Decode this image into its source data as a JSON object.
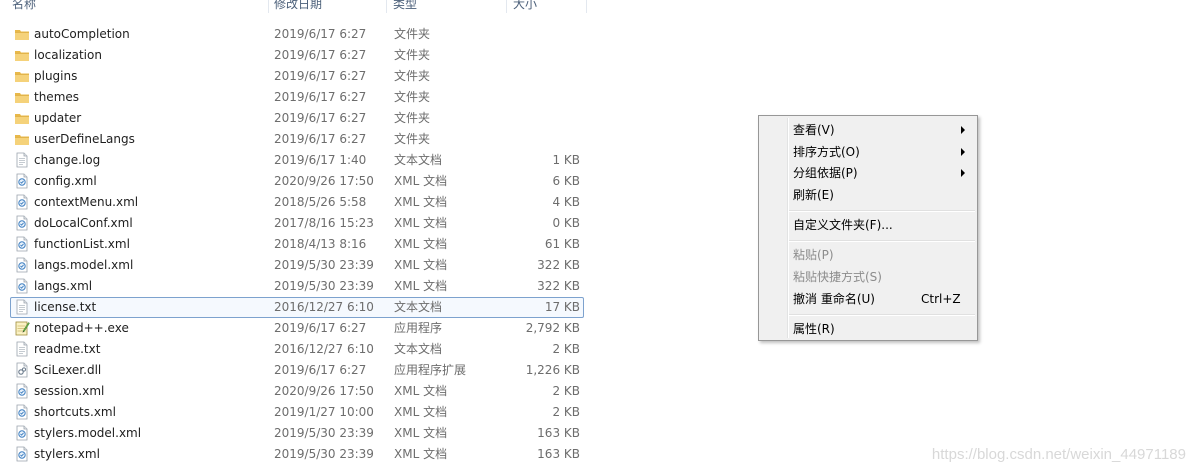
{
  "columns": {
    "name": "名称",
    "date": "修改日期",
    "type": "类型",
    "size": "大小"
  },
  "files": [
    {
      "name": "autoCompletion",
      "date": "2019/6/17 6:27",
      "type": "文件夹",
      "size": "",
      "icon": "folder-icon"
    },
    {
      "name": "localization",
      "date": "2019/6/17 6:27",
      "type": "文件夹",
      "size": "",
      "icon": "folder-icon"
    },
    {
      "name": "plugins",
      "date": "2019/6/17 6:27",
      "type": "文件夹",
      "size": "",
      "icon": "folder-icon"
    },
    {
      "name": "themes",
      "date": "2019/6/17 6:27",
      "type": "文件夹",
      "size": "",
      "icon": "folder-icon"
    },
    {
      "name": "updater",
      "date": "2019/6/17 6:27",
      "type": "文件夹",
      "size": "",
      "icon": "folder-icon"
    },
    {
      "name": "userDefineLangs",
      "date": "2019/6/17 6:27",
      "type": "文件夹",
      "size": "",
      "icon": "folder-icon"
    },
    {
      "name": "change.log",
      "date": "2019/6/17 1:40",
      "type": "文本文档",
      "size": "1 KB",
      "icon": "text-file-icon"
    },
    {
      "name": "config.xml",
      "date": "2020/9/26 17:50",
      "type": "XML 文档",
      "size": "6 KB",
      "icon": "xml-file-icon"
    },
    {
      "name": "contextMenu.xml",
      "date": "2018/5/26 5:58",
      "type": "XML 文档",
      "size": "4 KB",
      "icon": "xml-file-icon"
    },
    {
      "name": "doLocalConf.xml",
      "date": "2017/8/16 15:23",
      "type": "XML 文档",
      "size": "0 KB",
      "icon": "xml-file-icon"
    },
    {
      "name": "functionList.xml",
      "date": "2018/4/13 8:16",
      "type": "XML 文档",
      "size": "61 KB",
      "icon": "xml-file-icon"
    },
    {
      "name": "langs.model.xml",
      "date": "2019/5/30 23:39",
      "type": "XML 文档",
      "size": "322 KB",
      "icon": "xml-file-icon"
    },
    {
      "name": "langs.xml",
      "date": "2019/5/30 23:39",
      "type": "XML 文档",
      "size": "322 KB",
      "icon": "xml-file-icon"
    },
    {
      "name": "license.txt",
      "date": "2016/12/27 6:10",
      "type": "文本文档",
      "size": "17 KB",
      "icon": "text-file-icon",
      "selected": true
    },
    {
      "name": "notepad++.exe",
      "date": "2019/6/17 6:27",
      "type": "应用程序",
      "size": "2,792 KB",
      "icon": "notepad-exe-icon"
    },
    {
      "name": "readme.txt",
      "date": "2016/12/27 6:10",
      "type": "文本文档",
      "size": "2 KB",
      "icon": "text-file-icon"
    },
    {
      "name": "SciLexer.dll",
      "date": "2019/6/17 6:27",
      "type": "应用程序扩展",
      "size": "1,226 KB",
      "icon": "dll-file-icon"
    },
    {
      "name": "session.xml",
      "date": "2020/9/26 17:50",
      "type": "XML 文档",
      "size": "2 KB",
      "icon": "xml-file-icon"
    },
    {
      "name": "shortcuts.xml",
      "date": "2019/1/27 10:00",
      "type": "XML 文档",
      "size": "2 KB",
      "icon": "xml-file-icon"
    },
    {
      "name": "stylers.model.xml",
      "date": "2019/5/30 23:39",
      "type": "XML 文档",
      "size": "163 KB",
      "icon": "xml-file-icon"
    },
    {
      "name": "stylers.xml",
      "date": "2019/5/30 23:39",
      "type": "XML 文档",
      "size": "163 KB",
      "icon": "xml-file-icon"
    }
  ],
  "context_menu": {
    "view": "查看(V)",
    "sort_by": "排序方式(O)",
    "group_by": "分组依据(P)",
    "refresh": "刷新(E)",
    "customize_folder": "自定义文件夹(F)...",
    "paste": "粘贴(P)",
    "paste_shortcut": "粘贴快捷方式(S)",
    "undo_rename": "撤消 重命名(U)",
    "undo_rename_shortcut": "Ctrl+Z",
    "properties": "属性(R)"
  },
  "watermark": "https://blog.csdn.net/weixin_44971189",
  "colors": {
    "selection_border": "#7da2ce",
    "folder": "#e8c15a",
    "header_text": "#4c607a"
  }
}
